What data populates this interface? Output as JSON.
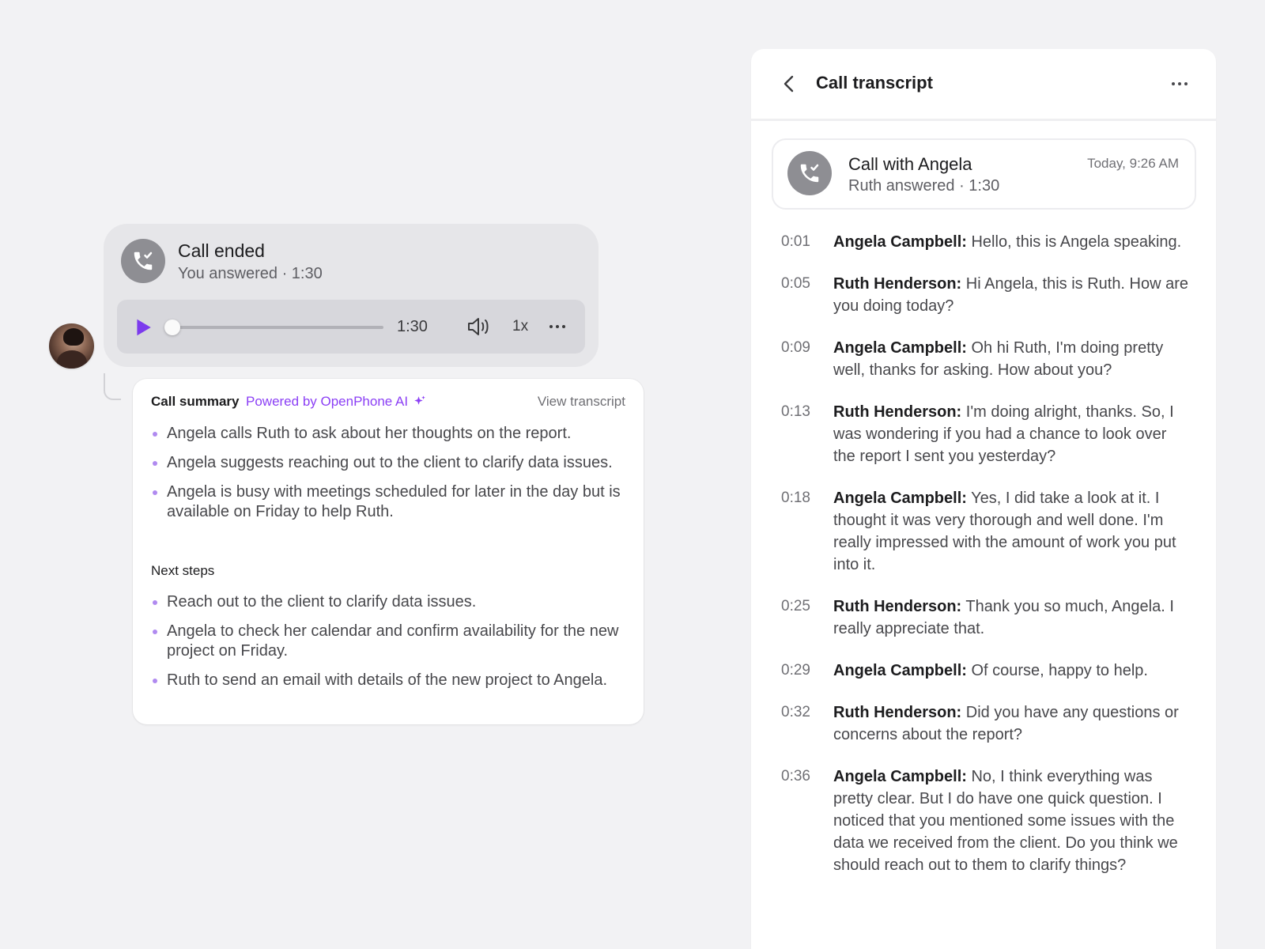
{
  "call_card": {
    "title": "Call ended",
    "subtitle": "You answered · 1:30",
    "player": {
      "duration": "1:30",
      "speed": "1x",
      "progress": 0
    }
  },
  "summary": {
    "title": "Call summary",
    "powered_by": "Powered by OpenPhone AI",
    "view_transcript": "View transcript",
    "points": [
      "Angela calls Ruth to ask about her thoughts on the report.",
      "Angela suggests reaching out to the client to clarify data issues.",
      "Angela is busy with meetings scheduled for later in the day but is available on Friday to help Ruth."
    ],
    "next_steps_title": "Next steps",
    "next_steps": [
      "Reach out to the client to clarify data issues.",
      "Angela to check her calendar and confirm availability for the new project on Friday.",
      "Ruth to send an email with details of the new project to Angela."
    ]
  },
  "transcript": {
    "header": "Call transcript",
    "call": {
      "title": "Call with Angela",
      "subtitle": "Ruth answered · 1:30",
      "time": "Today, 9:26 AM"
    },
    "lines": [
      {
        "time": "0:01",
        "speaker": "Angela Campbell:",
        "text": "Hello, this is Angela speaking."
      },
      {
        "time": "0:05",
        "speaker": "Ruth Henderson:",
        "text": "Hi Angela, this is Ruth. How are you doing today?"
      },
      {
        "time": "0:09",
        "speaker": "Angela Campbell:",
        "text": "Oh hi Ruth, I'm doing pretty well, thanks for asking. How about you?"
      },
      {
        "time": "0:13",
        "speaker": "Ruth Henderson:",
        "text": "I'm doing alright, thanks. So, I was wondering if you had a chance to look over the report I sent you yesterday?"
      },
      {
        "time": "0:18",
        "speaker": "Angela Campbell:",
        "text": "Yes, I did take a look at it. I thought it was very thorough and well done. I'm really impressed with the amount of work you put into it."
      },
      {
        "time": "0:25",
        "speaker": "Ruth Henderson:",
        "text": "Thank you so much, Angela. I really appreciate that."
      },
      {
        "time": "0:29",
        "speaker": "Angela Campbell:",
        "text": "Of course, happy to help."
      },
      {
        "time": "0:32",
        "speaker": "Ruth Henderson:",
        "text": "Did you have any questions or concerns about the report?"
      },
      {
        "time": "0:36",
        "speaker": "Angela Campbell:",
        "text": "No, I think everything was pretty clear. But I do have one quick question. I noticed that you mentioned some issues with the data we received from the client. Do you think we should reach out to them to clarify things?"
      }
    ]
  },
  "colors": {
    "accent": "#8b3ff5",
    "play": "#7c3aed",
    "bullet": "#b08af0",
    "icon_circle": "#8e8e93"
  },
  "icons": [
    "user-avatar",
    "phone-check-icon",
    "play-icon",
    "volume-icon",
    "more-horizontal-icon",
    "sparkle-icon",
    "chevron-left-icon"
  ]
}
